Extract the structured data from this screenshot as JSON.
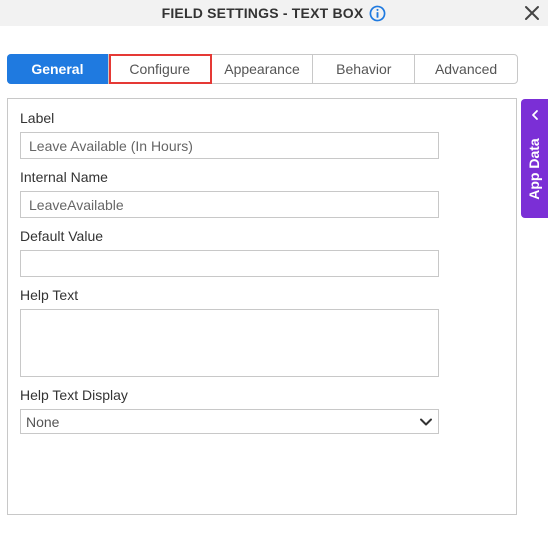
{
  "dialog": {
    "title": "FIELD SETTINGS - TEXT BOX",
    "info_icon": "info-icon",
    "close_icon": "close-icon"
  },
  "tabs": [
    {
      "label": "General",
      "active": true
    },
    {
      "label": "Configure",
      "active": false,
      "highlighted": true
    },
    {
      "label": "Appearance",
      "active": false
    },
    {
      "label": "Behavior",
      "active": false
    },
    {
      "label": "Advanced",
      "active": false
    }
  ],
  "form": {
    "label": {
      "label": "Label",
      "value": "Leave Available (In Hours)"
    },
    "internal_name": {
      "label": "Internal Name",
      "value": "LeaveAvailable"
    },
    "default_value": {
      "label": "Default Value",
      "value": ""
    },
    "help_text": {
      "label": "Help Text",
      "value": ""
    },
    "help_text_display": {
      "label": "Help Text Display",
      "selected": "None"
    }
  },
  "side_panel": {
    "label": "App Data",
    "icon": "chevron-left-icon"
  },
  "colors": {
    "accent": "#1f7ae0",
    "app_data": "#7b2fd6",
    "highlight_border": "#e53935"
  }
}
